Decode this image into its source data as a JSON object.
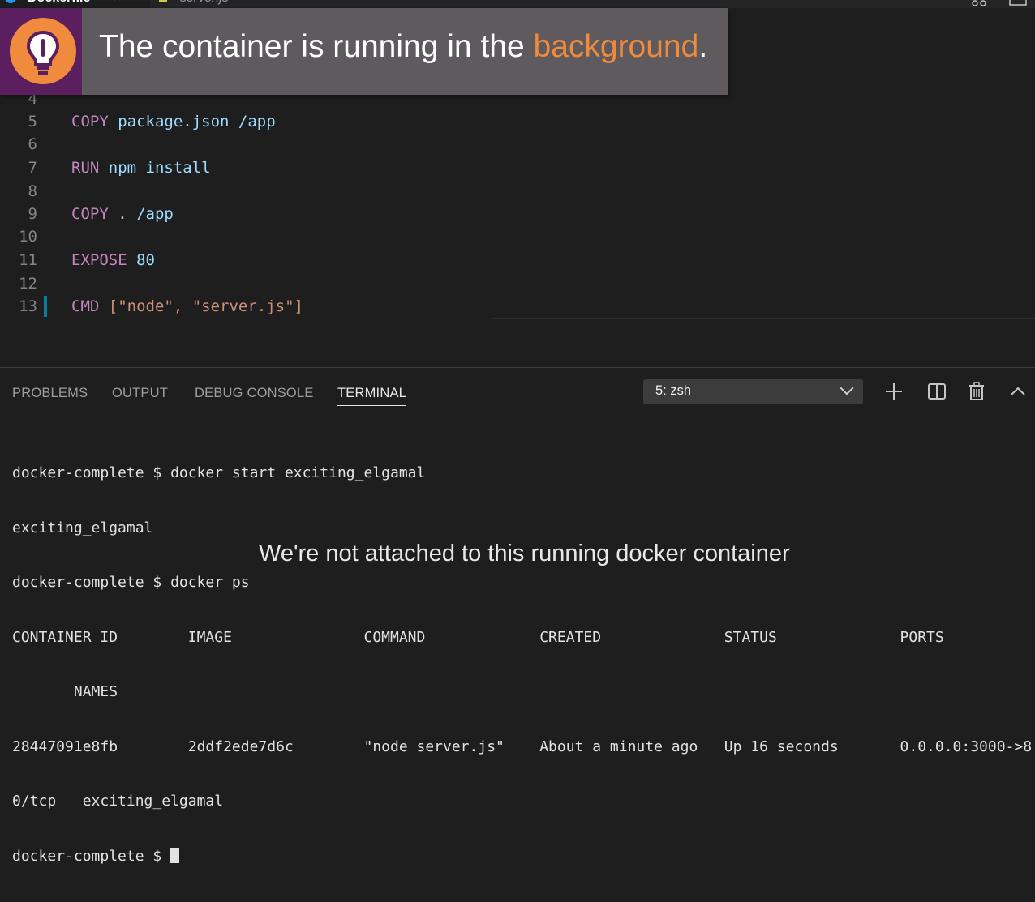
{
  "tabs": [
    {
      "label": "Dockerfile",
      "close": "×",
      "icon": "docker-icon"
    },
    {
      "label": "server.js",
      "icon": "js-file-icon"
    }
  ],
  "banner": {
    "text_before": "The container is running in the ",
    "highlight": "background",
    "text_after": ".",
    "highlight_color": "#f08a3c",
    "icon": "lightbulb-icon"
  },
  "editor": {
    "lines": [
      {
        "num": "4",
        "keyword": "",
        "rest": ""
      },
      {
        "num": "5",
        "keyword": "COPY",
        "rest": "package.json /app"
      },
      {
        "num": "6",
        "keyword": "",
        "rest": ""
      },
      {
        "num": "7",
        "keyword": "RUN",
        "rest": "npm install"
      },
      {
        "num": "8",
        "keyword": "",
        "rest": ""
      },
      {
        "num": "9",
        "keyword": "COPY",
        "rest": ". /app"
      },
      {
        "num": "10",
        "keyword": "",
        "rest": ""
      },
      {
        "num": "11",
        "keyword": "EXPOSE",
        "rest": "80"
      },
      {
        "num": "12",
        "keyword": "",
        "rest": ""
      },
      {
        "num": "13",
        "keyword": "CMD",
        "rest": "[\"node\", \"server.js\"]"
      }
    ]
  },
  "panel": {
    "tabs": [
      "PROBLEMS",
      "OUTPUT",
      "DEBUG CONSOLE",
      "TERMINAL"
    ],
    "active_tab": "TERMINAL",
    "terminal_select": "5: zsh",
    "icons": [
      "plus-icon",
      "split-icon",
      "trash-icon",
      "chevron-up-icon"
    ]
  },
  "terminal": {
    "lines": [
      "docker-complete $ docker start exciting_elgamal",
      "exciting_elgamal",
      "docker-complete $ docker ps",
      "CONTAINER ID        IMAGE               COMMAND             CREATED              STATUS              PORTS",
      "       NAMES",
      "28447091e8fb        2ddf2ede7d6c        \"node server.js\"    About a minute ago   Up 16 seconds       0.0.0.0:3000->8",
      "0/tcp   exciting_elgamal",
      "docker-complete $ "
    ]
  },
  "subtitle": "We're not attached to this running docker container"
}
